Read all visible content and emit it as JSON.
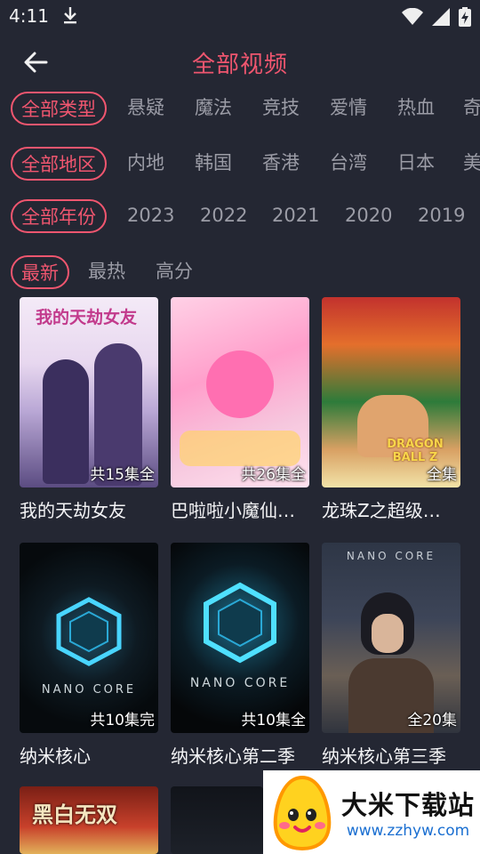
{
  "status": {
    "time": "4:11"
  },
  "header": {
    "title": "全部视频"
  },
  "filters": {
    "types": [
      "全部类型",
      "悬疑",
      "魔法",
      "竞技",
      "爱情",
      "热血",
      "奇"
    ],
    "regions": [
      "全部地区",
      "内地",
      "韩国",
      "香港",
      "台湾",
      "日本",
      "美"
    ],
    "years": [
      "全部年份",
      "2023",
      "2022",
      "2021",
      "2020",
      "2019"
    ],
    "sort": [
      "最新",
      "最热",
      "高分"
    ]
  },
  "posters": [
    {
      "overlay": "我的天劫女友"
    },
    {
      "overlay": ""
    },
    {
      "overlay": "DRAGON BALL Z"
    },
    {
      "overlay": "NANO CORE"
    },
    {
      "overlay": "NANO CORE"
    },
    {
      "overlay": "NANO CORE"
    },
    {
      "overlay": "黑白无双"
    },
    {
      "overlay": ""
    }
  ],
  "videos": [
    {
      "name": "我的天劫女友",
      "episodes": "共15集全"
    },
    {
      "name": "巴啦啦小魔仙…",
      "episodes": "共26集全"
    },
    {
      "name": "龙珠Z之超级…",
      "episodes": "全集"
    },
    {
      "name": "纳米核心",
      "episodes": "共10集完"
    },
    {
      "name": "纳米核心第二季",
      "episodes": "共10集全"
    },
    {
      "name": "纳米核心第三季",
      "episodes": "全20集"
    }
  ],
  "ad": {
    "title": "大米下载站",
    "url": "www.zzhyw.com"
  }
}
